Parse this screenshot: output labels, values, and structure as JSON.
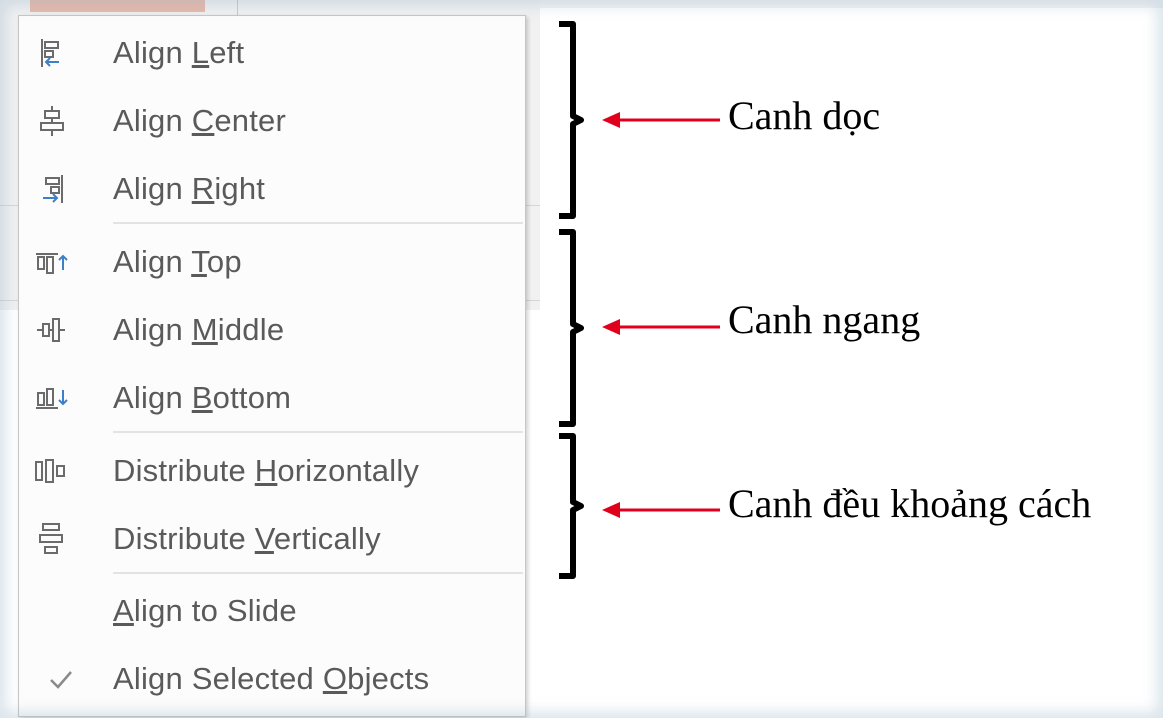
{
  "menu": {
    "items": [
      {
        "pre": "Align ",
        "key": "L",
        "post": "eft",
        "icon": "align-left-icon"
      },
      {
        "pre": "Align ",
        "key": "C",
        "post": "enter",
        "icon": "align-center-icon"
      },
      {
        "pre": "Align ",
        "key": "R",
        "post": "ight",
        "icon": "align-right-icon"
      },
      {
        "pre": "Align ",
        "key": "T",
        "post": "op",
        "icon": "align-top-icon"
      },
      {
        "pre": "Align ",
        "key": "M",
        "post": "iddle",
        "icon": "align-middle-icon"
      },
      {
        "pre": "Align ",
        "key": "B",
        "post": "ottom",
        "icon": "align-bottom-icon"
      },
      {
        "pre": "Distribute ",
        "key": "H",
        "post": "orizontally",
        "icon": "distribute-horizontally-icon"
      },
      {
        "pre": "Distribute ",
        "key": "V",
        "post": "ertically",
        "icon": "distribute-vertically-icon"
      },
      {
        "pre": "",
        "key": "A",
        "post": "lign to Slide",
        "icon": ""
      },
      {
        "pre": "Align Selected ",
        "key": "O",
        "post": "bjects",
        "icon": "checkmark-icon"
      }
    ]
  },
  "annotations": {
    "group1": "Canh dọc",
    "group2": "Canh ngang",
    "group3": "Canh đều khoảng cách"
  },
  "colors": {
    "arrow": "#e0001b",
    "icon_blue": "#3f7fc8",
    "icon_gray": "#6b6b6b",
    "menu_text": "#5a5a5a"
  }
}
